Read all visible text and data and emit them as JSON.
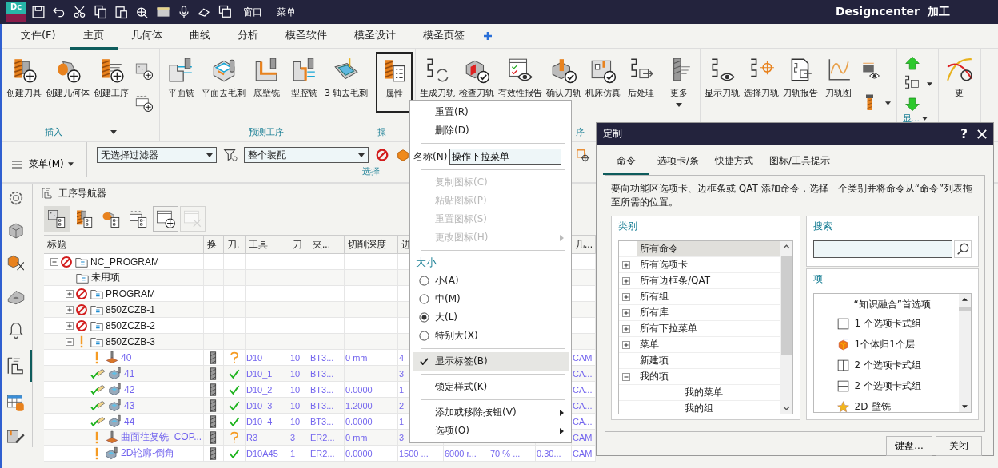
{
  "title_bar": {
    "badge": "Dc",
    "window_menu": "窗口",
    "menu": "菜单",
    "app_name": "Designcenter",
    "mode": "加工"
  },
  "ribbon_tabs": [
    {
      "label": "文件(F)",
      "selected": false
    },
    {
      "label": "主页",
      "selected": true
    },
    {
      "label": "几何体",
      "selected": false
    },
    {
      "label": "曲线",
      "selected": false
    },
    {
      "label": "分析",
      "selected": false
    },
    {
      "label": "模圣软件",
      "selected": false
    },
    {
      "label": "模圣设计",
      "selected": false
    },
    {
      "label": "模圣页签",
      "selected": false
    }
  ],
  "ribbon_groups": [
    {
      "label": "插入",
      "launcher": true,
      "buttons": [
        {
          "label": "创建刀具",
          "kind": "create-tool"
        },
        {
          "label": "创建几何体",
          "kind": "create-geometry"
        },
        {
          "label": "创建工序",
          "kind": "create-operation"
        },
        {
          "kind": "stack",
          "items": [
            {
              "kind": "stock"
            },
            {
              "kind": "blank"
            }
          ]
        }
      ]
    },
    {
      "label": "预测工序",
      "buttons": [
        {
          "label": "平面铣",
          "kind": "planar-mill"
        },
        {
          "label": "平面去毛刺",
          "kind": "deburr"
        },
        {
          "label": "底壁铣",
          "kind": "floor-wall"
        },
        {
          "label": "型腔铣",
          "kind": "cavity"
        },
        {
          "label": "3 轴去毛刺",
          "kind": "tray-deburr"
        }
      ]
    },
    {
      "label": "操",
      "buttons": [
        {
          "label": "属性",
          "kind": "properties",
          "selected": true
        }
      ]
    },
    {
      "label": "序",
      "buttons": [
        {
          "label": "生成刀轨",
          "kind": "generate"
        },
        {
          "label": "检查刀轨",
          "kind": "verify"
        },
        {
          "label": "有效性报告",
          "kind": "validity"
        },
        {
          "label": "确认刀轨",
          "kind": "confirm"
        },
        {
          "label": "机床仿真",
          "kind": "simulate"
        },
        {
          "label": "后处理",
          "kind": "postprocess"
        },
        {
          "label": "更多",
          "kind": "more",
          "dropdown": true
        }
      ]
    },
    {
      "buttons": [
        {
          "label": "显示刀轨",
          "kind": "display-path"
        },
        {
          "label": "选择刀轨",
          "kind": "select-path"
        },
        {
          "label": "刀轨报告",
          "kind": "path-report"
        },
        {
          "label": "刀轨图",
          "kind": "path-graph"
        },
        {
          "kind": "stack",
          "items": [
            {
              "kind": "tool-display"
            },
            {
              "kind": "tool-bit",
              "dropdown": true
            }
          ]
        }
      ]
    },
    {
      "buttons": [
        {
          "kind": "stack",
          "items": [
            {
              "kind": "up"
            },
            {
              "kind": "layout",
              "dropdown": true
            },
            {
              "kind": "down"
            },
            {
              "kind": "text",
              "label": "显...",
              "dropdown": true
            }
          ]
        }
      ]
    },
    {
      "buttons": [
        {
          "label": "更",
          "kind": "curves"
        }
      ]
    }
  ],
  "selection_bar": {
    "menu": "菜单(M)",
    "filters": [
      {
        "value": "无选择过滤器"
      },
      {
        "value": "整个装配"
      }
    ],
    "group_label": "选择"
  },
  "sidebar": [
    {
      "kind": "settings",
      "selected": false
    },
    {
      "kind": "part",
      "selected": false
    },
    {
      "kind": "assembly",
      "selected": false
    },
    {
      "kind": "constraint",
      "selected": false
    },
    {
      "kind": "bell",
      "selected": false
    },
    {
      "kind": "navigator",
      "selected": true
    },
    {
      "kind": "spreadsheet",
      "selected": false
    },
    {
      "kind": "machine-tool",
      "selected": false
    }
  ],
  "navigator": {
    "title": "工序导航器",
    "toolbar": [
      {
        "kind": "program-view",
        "selected": true,
        "disabled": false
      },
      {
        "kind": "tool-view",
        "selected": false,
        "disabled": false
      },
      {
        "kind": "geometry-view",
        "selected": false,
        "disabled": false
      },
      {
        "kind": "method-view",
        "selected": false,
        "disabled": false
      },
      {
        "kind": "create-window",
        "selected": false,
        "disabled": false
      },
      {
        "kind": "delete-window",
        "selected": false,
        "disabled": true
      }
    ],
    "columns": [
      "标题",
      "换",
      "刀.",
      "工具",
      "刀",
      "夹...",
      "切削深度",
      "进",
      null,
      null,
      null,
      "几..."
    ],
    "rows": [
      {
        "name": "NC_PROGRAM",
        "kind": "group",
        "marker": {
          "kind": "blocked"
        },
        "expanded": true,
        "children": [
          {
            "name": "未用项",
            "kind": "group"
          },
          {
            "name": "PROGRAM",
            "kind": "group",
            "marker": {
              "kind": "blocked"
            },
            "expanded": false
          },
          {
            "name": "850ZCZB-1",
            "kind": "group",
            "marker": {
              "kind": "blocked"
            },
            "expanded": false
          },
          {
            "name": "850ZCZB-2",
            "kind": "group",
            "marker": {
              "kind": "blocked"
            },
            "expanded": false
          },
          {
            "name": "850ZCZB-3",
            "kind": "group",
            "marker": {
              "kind": "warning"
            },
            "expanded": true,
            "children": [
              {
                "name": "40",
                "kind": "drill",
                "marker": {
                  "kind": "warning"
                },
                "tool_change": true,
                "verified": false,
                "cells": [
                  "D10",
                  "10",
                  "BT3...",
                  "0 mm",
                  "4",
                  null,
                  null,
                  null,
                  "CAM"
                ]
              },
              {
                "name": "41",
                "kind": "cavity",
                "marker": {
                  "kind": "done"
                },
                "tool_change": true,
                "verified": true,
                "cells": [
                  "D10_1",
                  "10",
                  "BT3...",
                  null,
                  "3",
                  null,
                  null,
                  null,
                  "CA..."
                ]
              },
              {
                "name": "42",
                "kind": "cavity",
                "marker": {
                  "kind": "done"
                },
                "tool_change": true,
                "verified": true,
                "cells": [
                  "D10_2",
                  "10",
                  "BT3...",
                  "0.0000",
                  "1",
                  null,
                  null,
                  null,
                  "CA..."
                ]
              },
              {
                "name": "43",
                "kind": "cavity",
                "marker": {
                  "kind": "done"
                },
                "tool_change": true,
                "verified": true,
                "cells": [
                  "D10_3",
                  "10",
                  "BT3...",
                  "1.2000",
                  "2",
                  null,
                  null,
                  null,
                  "CA..."
                ]
              },
              {
                "name": "44",
                "kind": "cavity",
                "marker": {
                  "kind": "done"
                },
                "tool_change": true,
                "verified": true,
                "cells": [
                  "D10_4",
                  "10",
                  "BT3...",
                  "0.0000",
                  "1",
                  null,
                  null,
                  null,
                  "CA..."
                ]
              },
              {
                "name": "曲面往复铣_COP...",
                "kind": "drill",
                "marker": {
                  "kind": "warning"
                },
                "tool_change": true,
                "verified": false,
                "cells": [
                  "R3",
                  "3",
                  "ER2...",
                  "0 mm",
                  "3",
                  null,
                  null,
                  null,
                  "CAM"
                ]
              },
              {
                "name": "2D轮廓-倒角",
                "kind": "cavity",
                "marker": {
                  "kind": "warning"
                },
                "tool_change": true,
                "verified": true,
                "cells": [
                  "D10A45",
                  "1",
                  "ER2...",
                  "0.0000",
                  "1500 ...",
                  "6000 r...",
                  "70 % ...",
                  "0.30...",
                  "CAM"
                ]
              }
            ]
          }
        ]
      }
    ]
  },
  "context_menu": {
    "sections": [
      [
        {
          "kind": "command",
          "label": "重置(R)",
          "disabled": false,
          "highlighted": false
        },
        {
          "kind": "command",
          "label": "删除(D)",
          "disabled": false,
          "highlighted": false
        }
      ],
      [
        {
          "kind": "field",
          "label": "名称(N)",
          "value": "操作下拉菜单"
        }
      ],
      [
        {
          "kind": "command",
          "label": "复制图标(C)",
          "disabled": true,
          "highlighted": false
        },
        {
          "kind": "command",
          "label": "粘贴图标(P)",
          "disabled": true,
          "highlighted": false
        },
        {
          "kind": "command",
          "label": "重置图标(S)",
          "disabled": true,
          "highlighted": false
        },
        {
          "kind": "submenu",
          "label": "更改图标(H)",
          "disabled": true,
          "highlighted": false
        }
      ],
      [
        {
          "kind": "header",
          "label": "大小"
        },
        {
          "kind": "radio",
          "label": "小(A)",
          "selected": false,
          "disabled": false,
          "highlighted": false
        },
        {
          "kind": "radio",
          "label": "中(M)",
          "selected": false,
          "disabled": false,
          "highlighted": false
        },
        {
          "kind": "radio",
          "label": "大(L)",
          "selected": true,
          "disabled": false,
          "highlighted": false
        },
        {
          "kind": "radio",
          "label": "特别大(X)",
          "selected": false,
          "disabled": false,
          "highlighted": false
        }
      ],
      [
        {
          "kind": "check",
          "label": "显示标签(B)",
          "checked": true,
          "disabled": false,
          "highlighted": true
        }
      ],
      [
        {
          "kind": "check",
          "label": "锁定样式(K)",
          "checked": false,
          "disabled": false,
          "highlighted": false
        }
      ],
      [
        {
          "kind": "submenu",
          "label": "添加或移除按钮(V)",
          "disabled": false,
          "highlighted": false
        },
        {
          "kind": "submenu",
          "label": "选项(O)",
          "disabled": false,
          "highlighted": false
        }
      ]
    ]
  },
  "dialog": {
    "title": "定制",
    "help": "?",
    "tabs": [
      {
        "label": "命令",
        "selected": true
      },
      {
        "label": "选项卡/条",
        "selected": false
      },
      {
        "label": "快捷方式",
        "selected": false
      },
      {
        "label": "图标/工具提示",
        "selected": false
      }
    ],
    "description": "要向功能区选项卡、边框条或 QAT 添加命令，选择一个类别并将命令从“命令”列表拖至所需的位置。",
    "categories_label": "类别",
    "categories": [
      {
        "label": "所有命令",
        "selected": true
      },
      {
        "label": "所有选项卡",
        "selected": false,
        "expanded": false
      },
      {
        "label": "所有边框条/QAT",
        "selected": false,
        "expanded": false
      },
      {
        "label": "所有组",
        "selected": false,
        "expanded": false
      },
      {
        "label": "所有库",
        "selected": false,
        "expanded": false
      },
      {
        "label": "所有下拉菜单",
        "selected": false,
        "expanded": false
      },
      {
        "label": "菜单",
        "selected": false,
        "expanded": false
      },
      {
        "label": "新建项",
        "selected": false
      },
      {
        "label": "我的项",
        "selected": false,
        "expanded": true,
        "children": [
          {
            "label": "我的菜单",
            "selected": false
          },
          {
            "label": "我的组",
            "selected": false
          }
        ]
      }
    ],
    "search_label": "搜索",
    "items_label": "项",
    "items": [
      {
        "label": "“知识融合”首选项",
        "kind": "header"
      },
      {
        "label": "1 个选项卡式组",
        "kind": "single-pane"
      },
      {
        "label": "1个体归1个层",
        "kind": "body-layer"
      },
      {
        "label": "2 个选项卡式组",
        "kind": "vertical-split"
      },
      {
        "label": "2 个选项卡式组",
        "kind": "horizontal-split"
      },
      {
        "label": "2D-壁铣",
        "kind": "wall-mill"
      }
    ],
    "buttons": [
      "键盘...",
      "关闭"
    ]
  }
}
